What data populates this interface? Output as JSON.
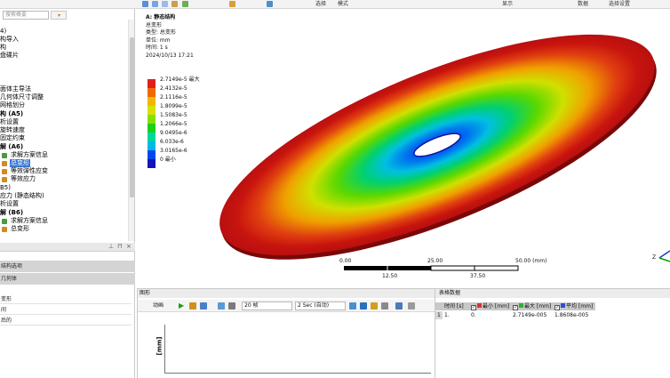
{
  "toolbar": {
    "select_label": "选择",
    "mode_label": "模式",
    "display_label": "显示",
    "extra_label": "数据",
    "right_label": "选择设置"
  },
  "tree": {
    "search_placeholder": "搜索概要",
    "items": [
      {
        "text": "4)"
      },
      {
        "text": "构导入"
      },
      {
        "text": "构"
      },
      {
        "text": "盘碟片"
      },
      {
        "text": "面体主导法"
      },
      {
        "text": "几何体尺寸调整"
      },
      {
        "text": "网格划分"
      },
      {
        "text": "构 (A5)"
      },
      {
        "text": "析设置"
      },
      {
        "text": "旋转速度"
      },
      {
        "text": "固定约束"
      },
      {
        "text": "解 (A6)"
      },
      {
        "text": "求解方案信息"
      },
      {
        "text": "总变形"
      },
      {
        "text": "等效弹性应变"
      },
      {
        "text": "等效应力"
      },
      {
        "text": "B5)"
      },
      {
        "text": "应力 (静态结构)"
      },
      {
        "text": "析设置"
      },
      {
        "text": "解 (B6)"
      },
      {
        "text": "求解方案信息"
      },
      {
        "text": "总变形"
      }
    ]
  },
  "properties": {
    "section1": "结构选项",
    "section2": "几何体",
    "rows": [
      "变形",
      "间",
      "后的"
    ]
  },
  "viewport": {
    "title": "A: 静态结构",
    "result": "总变形",
    "type": "类型: 总变形",
    "unit": "单位: mm",
    "time": "时间: 1 s",
    "date": "2024/10/13 17:21",
    "legend": [
      {
        "label": "2.7149e-5 最大",
        "color": "#e0201c"
      },
      {
        "label": "2.4132e-5",
        "color": "#f06a00"
      },
      {
        "label": "2.1116e-5",
        "color": "#f0b800"
      },
      {
        "label": "1.8099e-5",
        "color": "#d8e200"
      },
      {
        "label": "1.5083e-5",
        "color": "#88e000"
      },
      {
        "label": "1.2066e-5",
        "color": "#1ed01a"
      },
      {
        "label": "9.0495e-6",
        "color": "#00d8a0"
      },
      {
        "label": "6.033e-6",
        "color": "#00b8e6"
      },
      {
        "label": "3.0165e-6",
        "color": "#0048f0"
      },
      {
        "label": "0 最小",
        "color": "#1414b8"
      }
    ],
    "scale": {
      "top_ticks": [
        "0.00",
        "25.00",
        "50.00 (mm)"
      ],
      "bottom_ticks": [
        "12.50",
        "37.50"
      ]
    },
    "axis_label": "Z"
  },
  "graph": {
    "header": "图形",
    "animate": "动画",
    "frames": "20 帧",
    "duration": "2 Sec (自动)",
    "y_label": "[mm]"
  },
  "table": {
    "header": "表格数据",
    "columns": [
      "时间 [s]",
      "最小 [mm]",
      "最大 [mm]",
      "平均 [mm]"
    ],
    "rows": [
      {
        "index": "1",
        "time": "1.",
        "min": "0.",
        "max": "2.7149e-005",
        "avg": "1.8608e-005"
      }
    ]
  }
}
